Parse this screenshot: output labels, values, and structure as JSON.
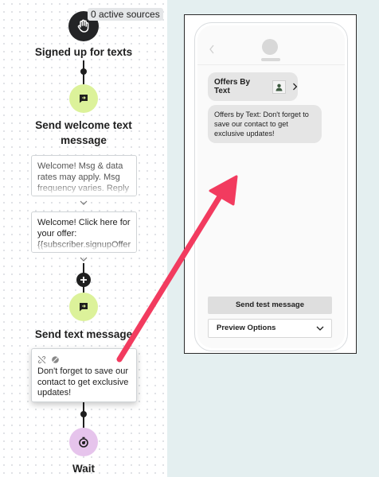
{
  "flow": {
    "source_badge": "0 active sources",
    "trigger_title": "Signed up for texts",
    "welcome_node_title_line1": "Send welcome text",
    "welcome_node_title_line2": "message",
    "welcome_card_1": "Welcome! Msg & data rates may apply. Msg frequency varies. Reply",
    "welcome_card_2": "Welcome! Click here for your offer: {{subscriber.signupOffer",
    "send_text_title": "Send text message",
    "selected_card_text": "Don't forget to save our contact to get exclusive updates!",
    "wait_title": "Wait"
  },
  "preview": {
    "sender_name": "Offers By Text",
    "bubble_text": "Offers by Text: Don't forget to save our contact to get exclusive updates!",
    "send_test_label": "Send test message",
    "preview_options_label": "Preview Options"
  },
  "colors": {
    "message_node": "#dcf29a",
    "wait_node": "#e6c4ec",
    "arrow": "#f23b5f"
  },
  "icons": [
    "hand-icon",
    "message-icon",
    "plus-icon",
    "timer-icon",
    "chevron-down-icon",
    "chevron-right-icon",
    "chevron-left-icon",
    "person-icon",
    "no-link-icon",
    "no-image-icon"
  ]
}
